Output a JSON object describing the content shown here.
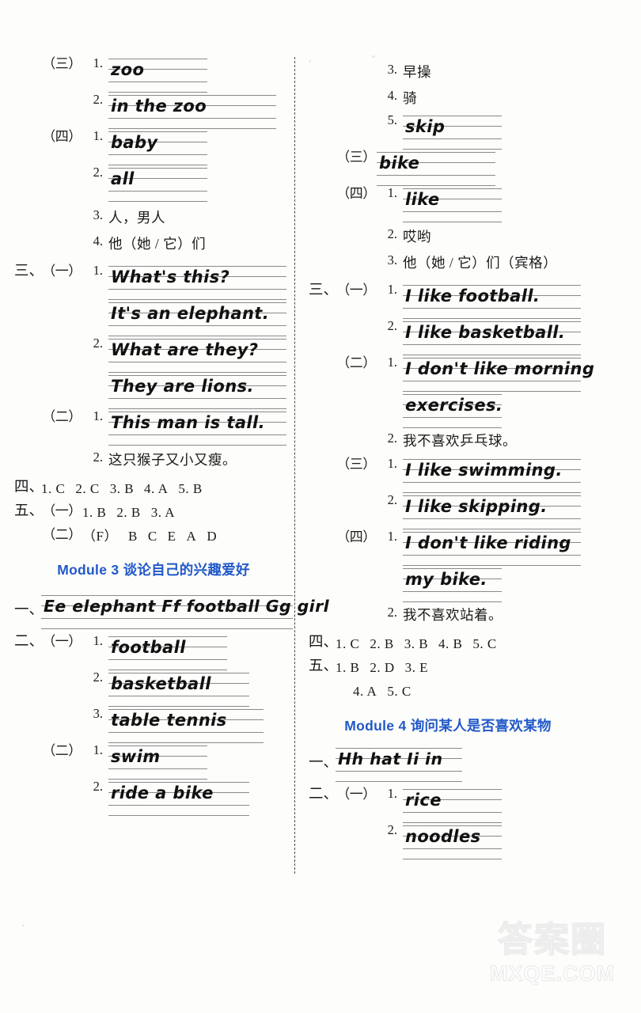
{
  "page": {
    "watermark_cn": "答案圈",
    "watermark_en": "MXQE.COM",
    "accent_color": "#2158c9"
  },
  "left_column": {
    "blocks": [
      {
        "group": "（三）",
        "items": [
          {
            "num": "1.",
            "type": "handwriting",
            "text": "zoo"
          },
          {
            "num": "2.",
            "type": "handwriting",
            "text": "in the zoo"
          }
        ]
      },
      {
        "group": "（四）",
        "items": [
          {
            "num": "1.",
            "type": "handwriting",
            "text": "baby"
          },
          {
            "num": "2.",
            "type": "handwriting",
            "text": "all"
          },
          {
            "num": "3.",
            "type": "chinese",
            "text": "人，男人"
          },
          {
            "num": "4.",
            "type": "chinese",
            "text": "他（她 / 它）们"
          }
        ]
      },
      {
        "section": "三、",
        "group": "（一）",
        "items": [
          {
            "num": "1.",
            "type": "handwriting",
            "text": "What's this?"
          },
          {
            "num": "",
            "type": "handwriting",
            "text": "It's an elephant."
          },
          {
            "num": "2.",
            "type": "handwriting",
            "text": "What are they?"
          },
          {
            "num": "",
            "type": "handwriting",
            "text": "They are lions."
          }
        ]
      },
      {
        "group": "（二）",
        "items": [
          {
            "num": "1.",
            "type": "handwriting",
            "text": "This man is tall."
          },
          {
            "num": "2.",
            "type": "chinese",
            "text": "这只猴子又小又瘦。"
          }
        ]
      }
    ],
    "answer_rows": [
      {
        "section": "四、",
        "group": "",
        "answers": [
          "1. C",
          "2. C",
          "3. B",
          "4. A",
          "5. B"
        ]
      },
      {
        "section": "五、",
        "group": "（一）",
        "answers": [
          "1. B",
          "2. B",
          "3. A"
        ]
      },
      {
        "section": "",
        "group": "（二）",
        "answers": [
          "（F）",
          "B",
          "C",
          "E",
          "A",
          "D"
        ]
      }
    ],
    "module_heading": "Module 3 谈论自己的兴趣爱好",
    "module3": {
      "alphabet_section": "一、",
      "alphabet_line": "Ee elephant Ff football Gg girl",
      "blocks": [
        {
          "section": "二、",
          "group": "（一）",
          "items": [
            {
              "num": "1.",
              "type": "handwriting",
              "text": "football"
            },
            {
              "num": "2.",
              "type": "handwriting",
              "text": "basketball"
            },
            {
              "num": "3.",
              "type": "handwriting",
              "text": "table tennis"
            }
          ]
        },
        {
          "group": "（二）",
          "items": [
            {
              "num": "1.",
              "type": "handwriting",
              "text": "swim"
            },
            {
              "num": "2.",
              "type": "handwriting",
              "text": "ride a bike"
            }
          ]
        }
      ]
    }
  },
  "right_column": {
    "top_items": [
      {
        "num": "3.",
        "type": "chinese",
        "text": "早操"
      },
      {
        "num": "4.",
        "type": "chinese",
        "text": "骑"
      },
      {
        "num": "5.",
        "type": "handwriting",
        "text": "skip"
      }
    ],
    "blocks": [
      {
        "group": "（三）",
        "items": [
          {
            "num": "",
            "type": "handwriting",
            "text": "bike"
          }
        ]
      },
      {
        "group": "（四）",
        "items": [
          {
            "num": "1.",
            "type": "handwriting",
            "text": "like"
          },
          {
            "num": "2.",
            "type": "chinese",
            "text": "哎哟"
          },
          {
            "num": "3.",
            "type": "chinese",
            "text": "他（她 / 它）们（宾格）"
          }
        ]
      },
      {
        "section": "三、",
        "group": "（一）",
        "items": [
          {
            "num": "1.",
            "type": "handwriting",
            "text": "I like football."
          },
          {
            "num": "2.",
            "type": "handwriting",
            "text": "I like basketball."
          }
        ]
      },
      {
        "group": "（二）",
        "items": [
          {
            "num": "1.",
            "type": "handwriting",
            "text": "I don't like morning"
          },
          {
            "num": "",
            "type": "handwriting",
            "text": "exercises."
          },
          {
            "num": "2.",
            "type": "chinese",
            "text": "我不喜欢乒乓球。"
          }
        ]
      },
      {
        "group": "（三）",
        "items": [
          {
            "num": "1.",
            "type": "handwriting",
            "text": "I like swimming."
          },
          {
            "num": "2.",
            "type": "handwriting",
            "text": "I like skipping."
          }
        ]
      },
      {
        "group": "（四）",
        "items": [
          {
            "num": "1.",
            "type": "handwriting",
            "text": "I don't like riding"
          },
          {
            "num": "",
            "type": "handwriting",
            "text": "my bike."
          },
          {
            "num": "2.",
            "type": "chinese",
            "text": "我不喜欢站着。"
          }
        ]
      }
    ],
    "answer_rows": [
      {
        "section": "四、",
        "group": "",
        "answers": [
          "1. C",
          "2. B",
          "3. B",
          "4. B",
          "5. C"
        ]
      },
      {
        "section": "五、",
        "group": "",
        "answers": [
          "1. B",
          "2. D",
          "3. E"
        ]
      },
      {
        "section": "",
        "group": "",
        "answers": [
          "4. A",
          "5. C"
        ]
      }
    ],
    "module_heading": "Module 4 询问某人是否喜欢某物",
    "module4": {
      "alphabet_section": "一、",
      "alphabet_line": "Hh hat  Ii in",
      "blocks": [
        {
          "section": "二、",
          "group": "（一）",
          "items": [
            {
              "num": "1.",
              "type": "handwriting",
              "text": "rice"
            },
            {
              "num": "2.",
              "type": "handwriting",
              "text": "noodles"
            }
          ]
        }
      ]
    }
  }
}
